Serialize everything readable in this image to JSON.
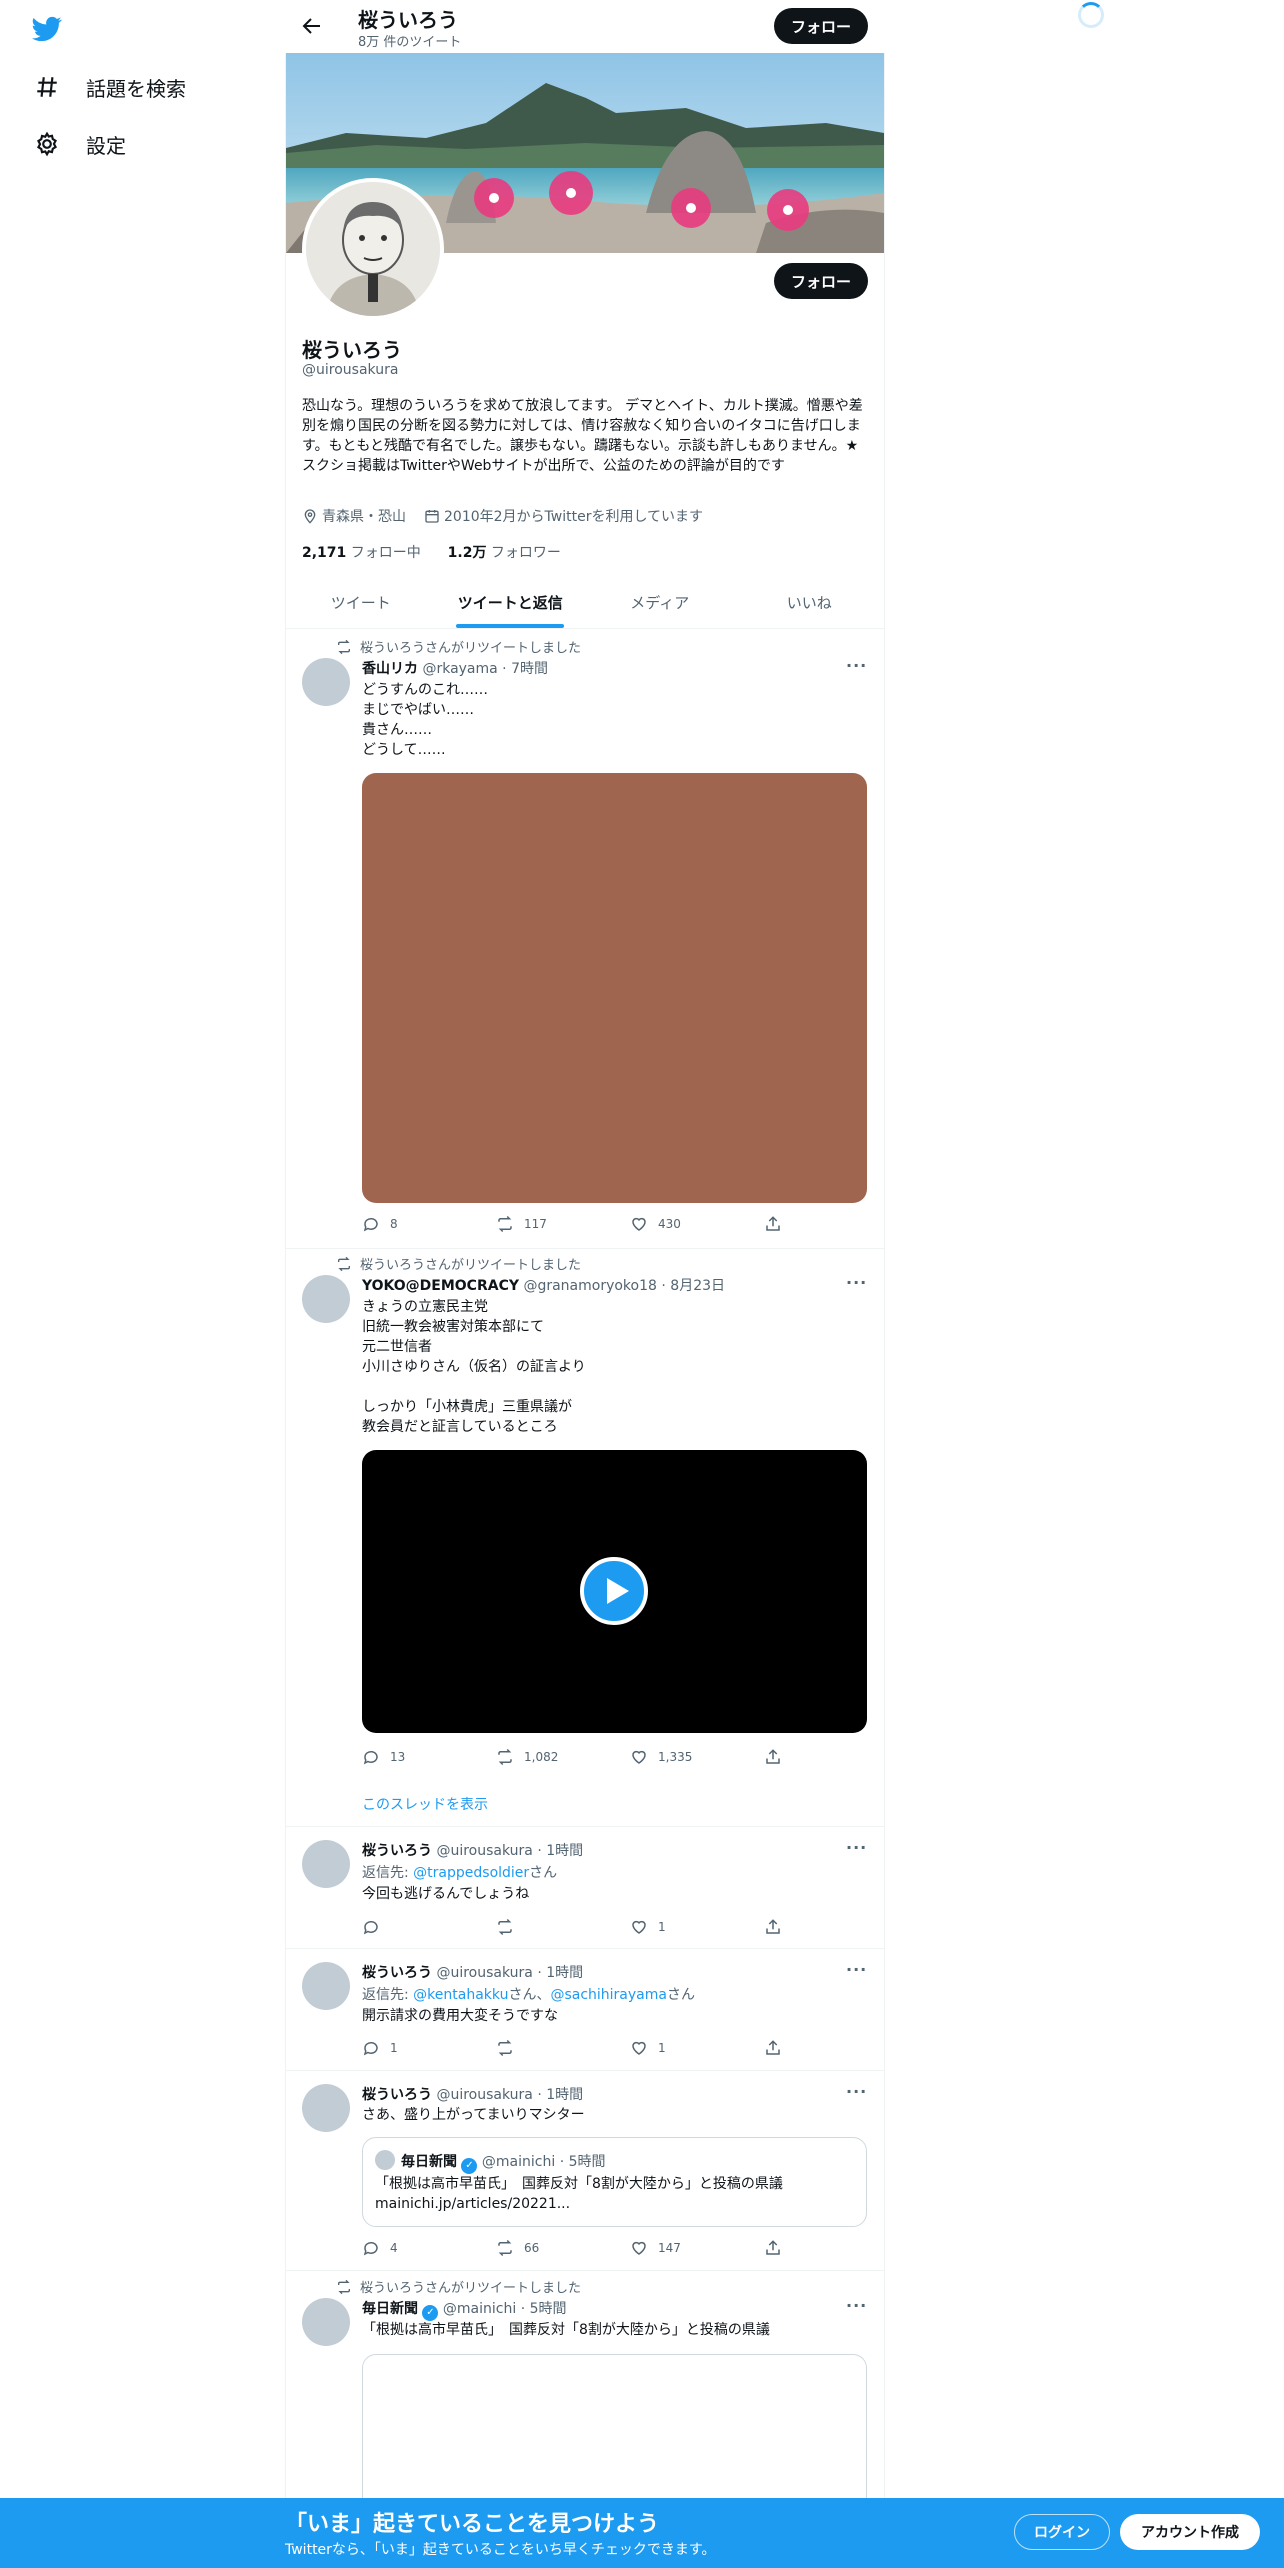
{
  "nav": {
    "items": [
      {
        "label": "話題を検索",
        "icon": "hashtag-icon"
      },
      {
        "label": "設定",
        "icon": "gear-icon"
      }
    ]
  },
  "header": {
    "name": "桜ういろう",
    "tweet_count": "8万 件のツイート",
    "follow_label": "フォロー"
  },
  "profile": {
    "follow_label": "フォロー",
    "name": "桜ういろう",
    "handle": "@uirousakura",
    "bio": "恐山なう。理想のういろうを求めて放浪してます。 デマとヘイト、カルト撲滅。憎悪や差別を煽り国民の分断を図る勢力に対しては、情け容赦なく知り合いのイタコに告げ口します。もともと残酷で有名でした。譲歩もない。躊躇もない。示談も許しもありません。★スクショ掲載はTwitterやWebサイトが出所で、公益のための評論が目的です",
    "location": "青森県・恐山",
    "joined": "2010年2月からTwitterを利用しています",
    "following_count": "2,171",
    "following_label": "フォロー中",
    "followers_count": "1.2万",
    "followers_label": "フォロワー"
  },
  "tabs": [
    {
      "label": "ツイート",
      "active": false
    },
    {
      "label": "ツイートと返信",
      "active": true
    },
    {
      "label": "メディア",
      "active": false
    },
    {
      "label": "いいね",
      "active": false
    }
  ],
  "tweets": [
    {
      "retweet_note": "桜ういろうさんがリツイートしました",
      "name": "香山リカ",
      "handle": "@rkayama",
      "time": "7時間",
      "text": "どうすんのこれ……\nまじでやばい……\n貴さん……\nどうして……",
      "media_color": "#a0654f",
      "replies": "8",
      "retweets": "117",
      "likes": "430"
    },
    {
      "retweet_note": "桜ういろうさんがリツイートしました",
      "name": "YOKO@DEMOCRACY",
      "handle": "@granamoryoko18",
      "time": "8月23日",
      "text": "きょうの立憲民主党\n旧統一教会被害対策本部にて\n元二世信者\n小川さゆりさん（仮名）の証言より\n\nしっかり「小林貴虎」三重県議が\n教会員だと証言しているところ",
      "replies": "13",
      "retweets": "1,082",
      "likes": "1,335",
      "thread_link": "このスレッドを表示"
    },
    {
      "name": "桜ういろう",
      "handle": "@uirousakura",
      "time": "1時間",
      "reply_prefix": "返信先: ",
      "reply_to_1": "@trappedsoldier",
      "reply_suffix_1": "さん",
      "text": "今回も逃げるんでしょうね",
      "replies": "",
      "retweets": "",
      "likes": "1"
    },
    {
      "name": "桜ういろう",
      "handle": "@uirousakura",
      "time": "1時間",
      "reply_prefix": "返信先: ",
      "reply_to_1": "@kentahakku",
      "reply_suffix_1": "さん、",
      "reply_to_2": "@sachihirayama",
      "reply_suffix_2": "さん",
      "text": "開示請求の費用大変そうですな",
      "replies": "1",
      "retweets": "",
      "likes": "1"
    },
    {
      "name": "桜ういろう",
      "handle": "@uirousakura",
      "time": "1時間",
      "text": "さあ、盛り上がってまいりマシター",
      "quote_name": "毎日新聞",
      "quote_handle": "@mainichi",
      "quote_time": "5時間",
      "quote_text": "「根拠は高市早苗氏」　国葬反対「8割が大陸から」と投稿の県議\nmainichi.jp/articles/20221...",
      "replies": "4",
      "retweets": "66",
      "likes": "147"
    },
    {
      "retweet_note": "桜ういろうさんがリツイートしました",
      "name": "毎日新聞",
      "handle": "@mainichi",
      "time": "5時間",
      "text": "「根拠は高市早苗氏」　国葬反対「8割が大陸から」と投稿の県議"
    }
  ],
  "bottom_bar": {
    "title": "「いま」起きていることを見つけよう",
    "subtitle": "Twitterなら、「いま」起きていることをいち早くチェックできます。",
    "login_label": "ログイン",
    "signup_label": "アカウント作成"
  },
  "colors": {
    "accent": "#1d9bf0",
    "dark_button": "#0f1419",
    "secondary_text": "#536471"
  }
}
